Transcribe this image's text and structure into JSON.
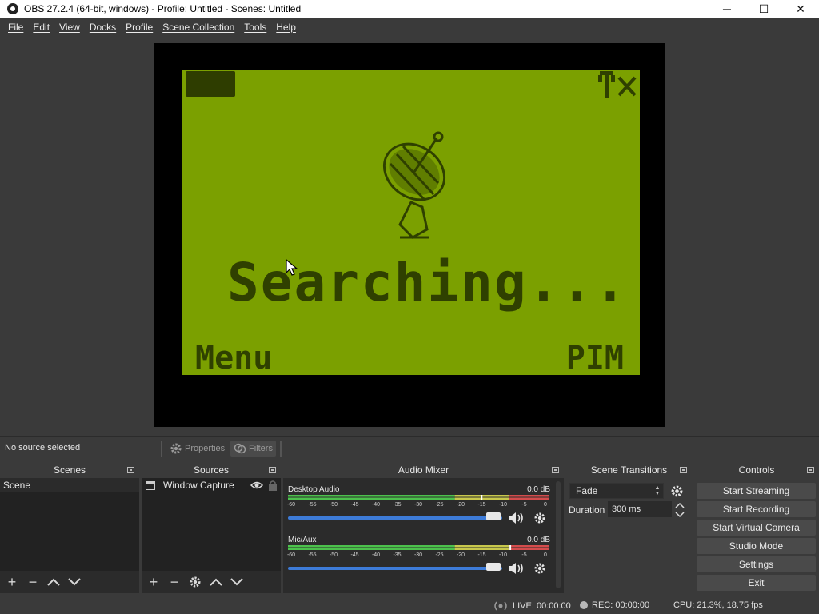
{
  "window": {
    "title": "OBS 27.2.4 (64-bit, windows) - Profile: Untitled - Scenes: Untitled",
    "minimize": "─",
    "maximize": "☐",
    "close": "✕"
  },
  "menu": [
    "File",
    "Edit",
    "View",
    "Docks",
    "Profile",
    "Scene Collection",
    "Tools",
    "Help"
  ],
  "preview": {
    "screen_text": "Searching...",
    "left_softkey": "Menu",
    "right_softkey": "PIM",
    "screen_color": "#7ba000",
    "ink_color": "#2f4000"
  },
  "context_bar": {
    "status": "No source selected",
    "properties": "Properties",
    "filters": "Filters"
  },
  "docks": {
    "scenes": {
      "title": "Scenes",
      "items": [
        "Scene"
      ]
    },
    "sources": {
      "title": "Sources",
      "items": [
        "Window Capture"
      ]
    },
    "mixer": {
      "title": "Audio Mixer",
      "channels": [
        {
          "name": "Desktop Audio",
          "db": "0.0 dB",
          "level": 0.74
        },
        {
          "name": "Mic/Aux",
          "db": "0.0 dB",
          "level": 0.85
        }
      ],
      "scale": [
        "-60",
        "-55",
        "-50",
        "-45",
        "-40",
        "-35",
        "-30",
        "-25",
        "-20",
        "-15",
        "-10",
        "-5",
        "0"
      ]
    },
    "transitions": {
      "title": "Scene Transitions",
      "selected": "Fade",
      "duration_label": "Duration",
      "duration_value": "300 ms"
    },
    "controls": {
      "title": "Controls",
      "buttons": [
        "Start Streaming",
        "Start Recording",
        "Start Virtual Camera",
        "Studio Mode",
        "Settings",
        "Exit"
      ]
    }
  },
  "status": {
    "live": "LIVE: 00:00:00",
    "rec": "REC: 00:00:00",
    "cpu": "CPU: 21.3%, 18.75 fps"
  }
}
